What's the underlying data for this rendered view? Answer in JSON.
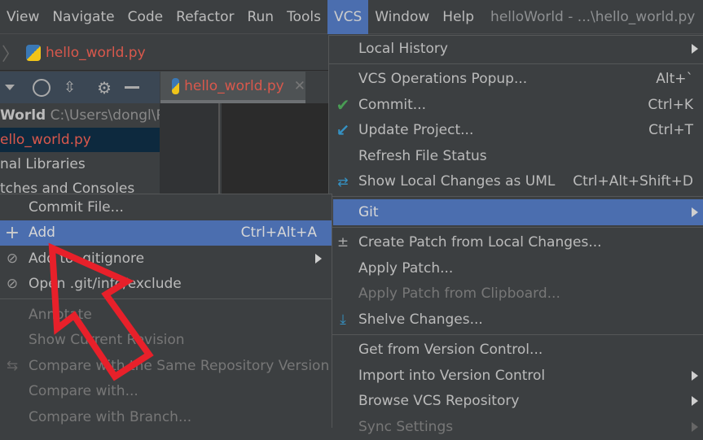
{
  "menubar": {
    "items": [
      "View",
      "Navigate",
      "Code",
      "Refactor",
      "Run",
      "Tools",
      "VCS",
      "Window",
      "Help"
    ],
    "active": "VCS",
    "title": "helloWorld - ...\\hello_world.py"
  },
  "breadcrumb": {
    "file": "hello_world.py"
  },
  "editor_tab": {
    "label": "hello_world.py"
  },
  "project_tree": {
    "root_name": "World",
    "root_path": "C:\\Users\\dongl\\P",
    "rows": [
      "ello_world.py",
      "nal Libraries",
      "tches and Consoles"
    ]
  },
  "vcs_menu": {
    "items": [
      {
        "label": "Local History",
        "submenu": true
      },
      {
        "label": "VCS Operations Popup...",
        "shortcut": "Alt+`"
      },
      {
        "label": "Commit...",
        "shortcut": "Ctrl+K",
        "icon": "check-icon"
      },
      {
        "label": "Update Project...",
        "shortcut": "Ctrl+T",
        "icon": "update-arrow-icon"
      },
      {
        "label": "Refresh File Status"
      },
      {
        "label": "Show Local Changes as UML",
        "shortcut": "Ctrl+Alt+Shift+D",
        "icon": "uml-icon"
      },
      {
        "label": "Git",
        "submenu": true,
        "selected": true
      },
      {
        "label": "Create Patch from Local Changes...",
        "icon": "patch-icon"
      },
      {
        "label": "Apply Patch..."
      },
      {
        "label": "Apply Patch from Clipboard...",
        "disabled": true
      },
      {
        "label": "Shelve Changes...",
        "icon": "shelve-icon"
      },
      {
        "label": "Get from Version Control..."
      },
      {
        "label": "Import into Version Control",
        "submenu": true
      },
      {
        "label": "Browse VCS Repository",
        "submenu": true
      },
      {
        "label": "Sync Settings",
        "submenu": true,
        "disabled": true
      }
    ]
  },
  "git_menu": {
    "items": [
      {
        "label": "Commit File..."
      },
      {
        "label": "Add",
        "shortcut": "Ctrl+Alt+A",
        "selected": true,
        "icon": "plus-icon"
      },
      {
        "label": "Add to .gitignore",
        "submenu": true,
        "icon": "ignore-file-icon"
      },
      {
        "label": "Open .git/info/exclude",
        "icon": "ignore-file-icon"
      },
      {
        "label": "Annotate",
        "disabled": true
      },
      {
        "label": "Show Current Revision",
        "disabled": true
      },
      {
        "label": "Compare with the Same Repository Version",
        "disabled": true,
        "icon": "compare-icon"
      },
      {
        "label": "Compare with...",
        "disabled": true
      },
      {
        "label": "Compare with Branch...",
        "disabled": true
      }
    ]
  },
  "colors": {
    "selection": "#4b6eaf",
    "annotation_arrow": "#e8202a",
    "file_modified": "#d9584c"
  }
}
